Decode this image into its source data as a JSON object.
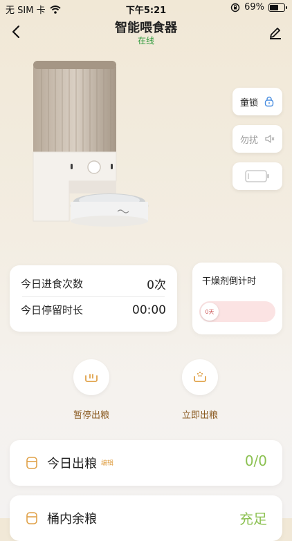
{
  "status_bar": {
    "carrier": "无 SIM 卡",
    "time": "下午5:21",
    "battery_percent": "69%",
    "battery_level": 0.69
  },
  "header": {
    "title": "智能喂食器",
    "status": "在线"
  },
  "side_buttons": {
    "child_lock": "童锁",
    "do_not_disturb": "勿扰"
  },
  "stats": {
    "meals_label": "今日进食次数",
    "meals_value": "0次",
    "stay_label": "今日停留时长",
    "stay_value": "00:00"
  },
  "desiccant": {
    "title": "干燥剂倒计时",
    "value": "0天",
    "progress": 0
  },
  "actions": {
    "pause_label": "暂停出粮",
    "dispense_label": "立即出粮"
  },
  "today_output": {
    "label": "今日出粮",
    "edit": "编辑",
    "value": "0/0"
  },
  "bucket": {
    "label": "桶内余粮",
    "value": "充足"
  },
  "colors": {
    "accent": "#e0a24a",
    "green": "#8cc152",
    "online": "#2e9a3b"
  }
}
